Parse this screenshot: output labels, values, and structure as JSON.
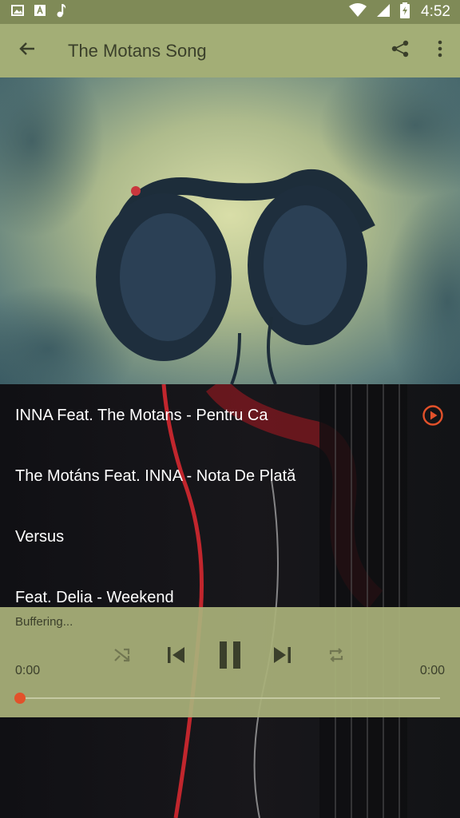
{
  "status_bar": {
    "time": "4:52",
    "icons_left": [
      "image-icon",
      "text-a-icon",
      "music-note-icon"
    ],
    "icons_right": [
      "wifi-icon",
      "signal-icon",
      "battery-icon"
    ]
  },
  "app_bar": {
    "title": "The Motans Song",
    "back_icon": "arrow-back-icon",
    "share_icon": "share-icon",
    "more_icon": "more-vert-icon"
  },
  "songs": [
    {
      "title": "INNA Feat. The Motans - Pentru Ca",
      "playing": true
    },
    {
      "title": "The Motáns Feat. INNA - Nota De Plată",
      "playing": false
    },
    {
      "title": "Versus",
      "playing": false
    },
    {
      "title": "Feat. Delia - Weekend",
      "playing": false
    }
  ],
  "player": {
    "status": "Buffering...",
    "elapsed": "0:00",
    "duration": "0:00",
    "progress": 0,
    "controls": [
      "shuffle-icon",
      "skip-previous-icon",
      "pause-icon",
      "skip-next-icon",
      "repeat-icon"
    ]
  },
  "colors": {
    "status_bar": "#7f8a57",
    "app_bar": "#a3ae76",
    "player_panel": "#a9b07a",
    "accent": "#e2512a"
  }
}
